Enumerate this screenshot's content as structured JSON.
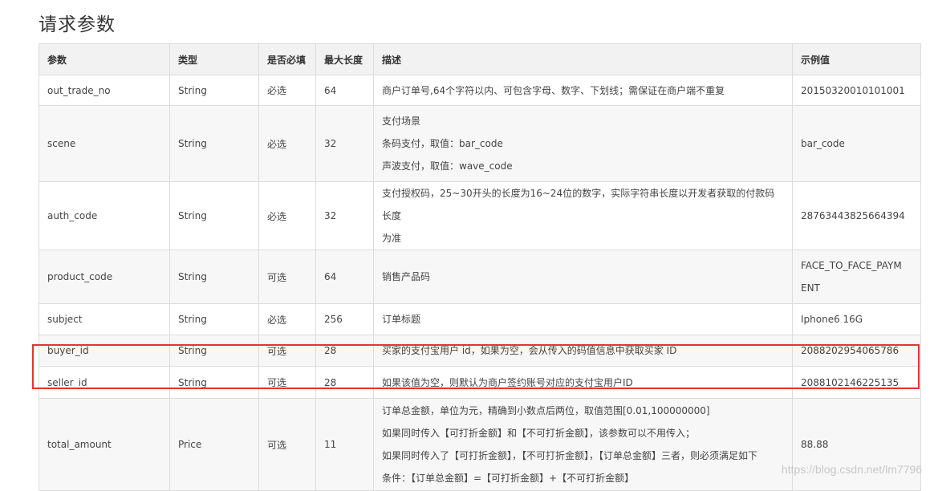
{
  "title": "请求参数",
  "headers": {
    "param": "参数",
    "type": "类型",
    "required": "是否必填",
    "max_length": "最大长度",
    "description": "描述",
    "example": "示例值"
  },
  "rows": [
    {
      "param": "out_trade_no",
      "type": "String",
      "required": "必选",
      "max_length": "64",
      "desc": [
        "商户订单号,64个字符以内、可包含字母、数字、下划线；需保证在商户端不重复"
      ],
      "example": [
        "2015032001010100​1"
      ]
    },
    {
      "param": "scene",
      "type": "String",
      "required": "必选",
      "max_length": "32",
      "desc": [
        "支付场景",
        "条码支付，取值：bar_code",
        "声波支付，取值：wave_code"
      ],
      "example": [
        "bar_code"
      ]
    },
    {
      "param": "auth_code",
      "type": "String",
      "required": "必选",
      "max_length": "32",
      "desc": [
        "支付授权码，25~30开头的长度为16~24位的数字，实际字符串长度以开发者获取的付款码长度",
        "为准"
      ],
      "example": [
        "28763443825664394"
      ]
    },
    {
      "param": "product_code",
      "type": "String",
      "required": "可选",
      "max_length": "64",
      "desc": [
        "销售产品码"
      ],
      "example": [
        "FACE_TO_FACE_PAYM",
        "ENT"
      ]
    },
    {
      "param": "subject",
      "type": "String",
      "required": "必选",
      "max_length": "256",
      "desc": [
        "订单标题"
      ],
      "example": [
        "Iphone6 16G"
      ]
    },
    {
      "param": "buyer_id",
      "type": "String",
      "required": "可选",
      "max_length": "28",
      "desc": [
        "买家的支付宝用户 id，如果为空，会从传入的码值信息中获取买家 ID"
      ],
      "example": [
        "2088202954065786"
      ]
    },
    {
      "param": "seller_id",
      "type": "String",
      "required": "可选",
      "max_length": "28",
      "desc": [
        "如果该值为空，则默认为商户签约账号对应的支付宝用户ID"
      ],
      "example": [
        "2088102146225135"
      ]
    },
    {
      "param": "total_amount",
      "type": "Price",
      "required": "可选",
      "max_length": "11",
      "desc": [
        "订单总金额，单位为元，精确到小数点后两位，取值范围[0.01,100000000]",
        "如果同时传入【可打折金额】和【不可打折金额】，该参数可以不用传入；",
        "如果同时传入了【可打折金额】，【不可打折金额】，【订单总金额】三者，则必须满足如下",
        "条件：【订单总金额】=【可打折金额】+【不可打折金额】"
      ],
      "example": [
        "88.88"
      ]
    }
  ],
  "watermark": "https://blog.csdn.net/lm7796"
}
